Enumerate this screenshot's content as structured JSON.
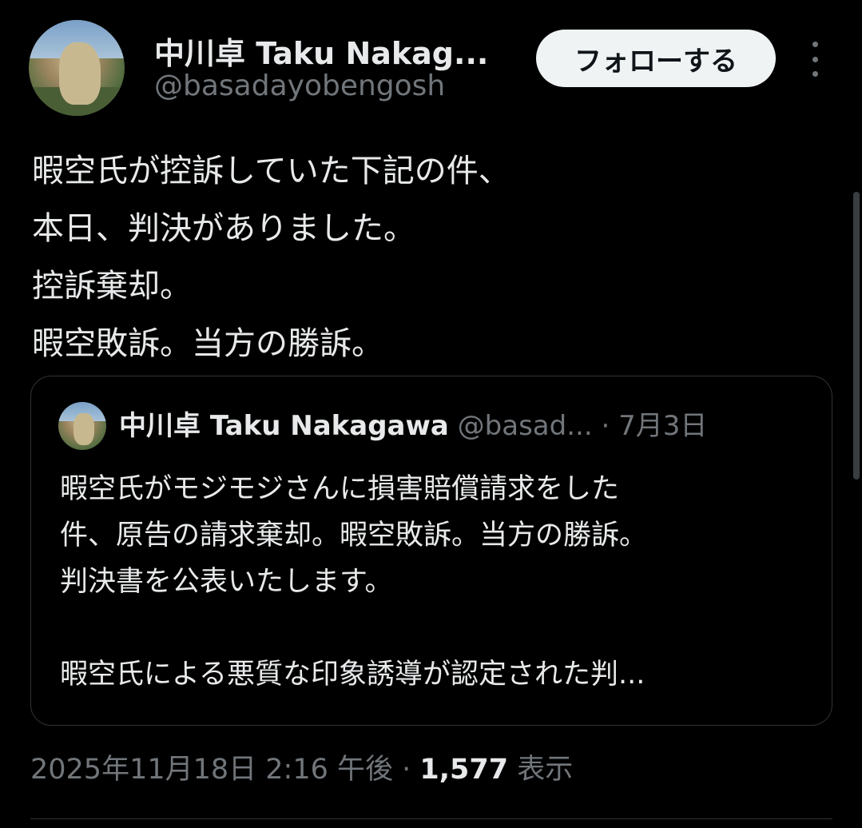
{
  "author": {
    "name": "中川卓 Taku Nakag...",
    "handle": "@basadayobengosh"
  },
  "follow_button": {
    "label": "フォローする"
  },
  "more_icon": "more-vertical-icon",
  "tweet": {
    "lines": [
      "暇空氏が控訴していた下記の件、",
      "本日、判決がありました。",
      "控訴棄却。",
      "暇空敗訴。当方の勝訴。"
    ]
  },
  "quote": {
    "name": "中川卓 Taku Nakagawa",
    "handle": "@basad...",
    "separator": " · ",
    "date": "7月3日",
    "lines": [
      "暇空氏がモジモジさんに損害賠償請求をした",
      "件、原告の請求棄却。暇空敗訴。当方の勝訴。",
      "判決書を公表いたします。",
      "",
      "暇空氏による悪質な印象誘導が認定された判..."
    ]
  },
  "meta": {
    "timestamp": "2025年11月18日 2:16 午後",
    "separator": " · ",
    "views_count": "1,577",
    "views_label": " 表示"
  },
  "colors": {
    "background": "#000000",
    "text": "#e7e9ea",
    "secondary": "#71767b",
    "border": "#2f3336",
    "button_bg": "#eff3f4"
  }
}
